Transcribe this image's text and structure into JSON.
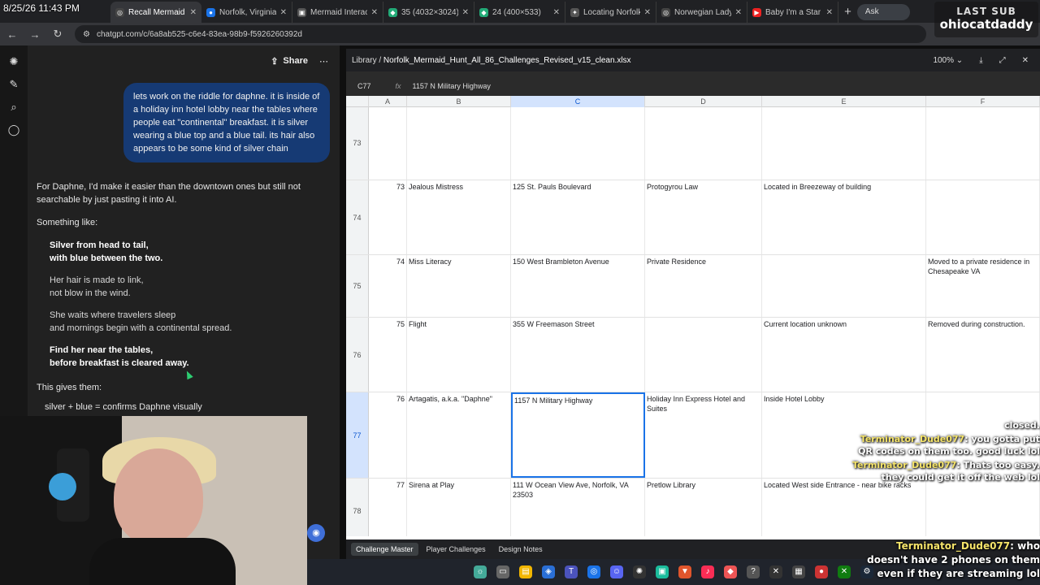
{
  "browser": {
    "timestamp": "8/25/26 11:43 PM",
    "tabs": [
      {
        "label": "Recall Mermaid S",
        "active": true,
        "fav": "◎",
        "color": "#444"
      },
      {
        "label": "Norfolk, Virginia -",
        "fav": "●",
        "color": "#1a73e8"
      },
      {
        "label": "Mermaid Interacti",
        "fav": "▣",
        "color": "#555"
      },
      {
        "label": "35 (4032×3024)",
        "fav": "◆",
        "color": "#2a7"
      },
      {
        "label": "24 (400×533)",
        "fav": "◆",
        "color": "#2a7"
      },
      {
        "label": "Locating Norfolk's",
        "fav": "✦",
        "color": "#555"
      },
      {
        "label": "Norwegian Lady S",
        "fav": "◎",
        "color": "#444"
      },
      {
        "label": "Baby I'm a Star - Y",
        "fav": "▶",
        "color": "#e22"
      }
    ],
    "ask_gemini": "Ask Gemini",
    "url": "chatgpt.com/c/6a8ab525-c6e4-83ea-98b9-f5926260392d"
  },
  "overlay": {
    "last_sub_label": "LAST SUB",
    "last_sub_name": "ohiocatdaddy"
  },
  "chat": {
    "share_label": "Share",
    "user_message": "lets work on the riddle for daphne. it is inside of a holiday inn hotel lobby near the tables where people eat \"continental\" breakfast. it is silver wearing a blue top and a blue tail. its hair also appears to be some kind of silver chain",
    "reply_intro": "For Daphne, I'd make it easier than the downtown ones but still not searchable by just pasting it into AI.",
    "something_like": "Something like:",
    "verses": [
      {
        "l1": "Silver from head to tail,",
        "l2": "with blue between the two.",
        "bold": true
      },
      {
        "l1": "Her hair is made to link,",
        "l2": "not blow in the wind.",
        "bold": false
      },
      {
        "l1": "She waits where travelers sleep",
        "l2": "and mornings begin with a continental spread.",
        "bold": false
      },
      {
        "l1": "Find her near the tables,",
        "l2": "before breakfast is cleared away.",
        "bold": true
      }
    ],
    "gives_them": "This gives them:",
    "partial_bullet": "silver + blue = confirms Daphne visually"
  },
  "sheet": {
    "library": "Library",
    "filename": "Norfolk_Mermaid_Hunt_All_86_Challenges_Revised_v15_clean.xlsx",
    "zoom": "100%",
    "cell_ref": "C77",
    "formula": "1157 N Military Highway",
    "columns": [
      "A",
      "B",
      "C",
      "D",
      "E",
      "F"
    ],
    "rows": [
      {
        "num": "73",
        "id": "",
        "name": "",
        "address": "",
        "site": "",
        "loc": "",
        "notes": ""
      },
      {
        "num": "74",
        "id": "73",
        "name": "Jealous Mistress",
        "address": "125 St. Pauls Boulevard",
        "site": "Protogyrou Law",
        "loc": "Located in Breezeway of building",
        "notes": ""
      },
      {
        "num": "75",
        "id": "74",
        "name": "Miss Literacy",
        "address": "150 West Brambleton Avenue",
        "site": "Private Residence",
        "loc": "",
        "notes": "Moved to a private residence in Chesapeake VA"
      },
      {
        "num": "76",
        "id": "75",
        "name": "Flight",
        "address": "355 W Freemason Street",
        "site": "",
        "loc": "Current location unknown",
        "notes": "Removed during construction."
      },
      {
        "num": "77",
        "id": "76",
        "name": "Artagatis, a.k.a. \"Daphne\"",
        "address": "1157 N Military Highway",
        "site": "Holiday Inn Express Hotel and Suites",
        "loc": "Inside Hotel Lobby",
        "notes": ""
      },
      {
        "num": "78",
        "id": "77",
        "name": "Sirena at Play",
        "address": "111 W Ocean View Ave, Norfolk, VA 23503",
        "site": "Pretlow Library",
        "loc": "Located West side Entrance - near bike racks",
        "notes": ""
      }
    ],
    "tabs": [
      "Challenge Master",
      "Player Challenges",
      "Design Notes"
    ]
  },
  "stream_chat": [
    {
      "user": "",
      "text": "closed."
    },
    {
      "user": "Terminator_Dude077",
      "text": ": you gotta put QR codes on them too. good luck lol"
    },
    {
      "user": "Terminator_Dude077",
      "text": ": Thats too easy. they could get it off the web lol"
    }
  ],
  "stream_big": {
    "user": "Terminator_Dude077",
    "text": ": who doesn't have 2 phones on them even if they are streaming lol"
  }
}
